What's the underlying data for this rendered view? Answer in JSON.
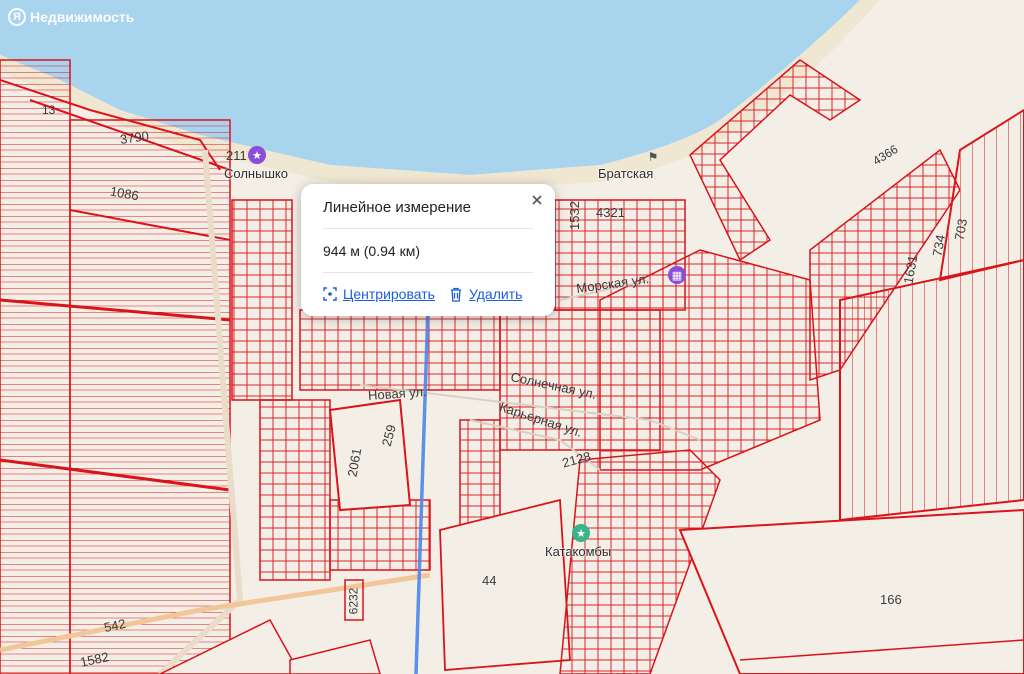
{
  "brand": {
    "name": "Недвижимость",
    "logo_letter": "Я"
  },
  "measure_popup": {
    "title": "Линейное измерение",
    "distance": "944 м (0.94 км)",
    "center_label": "Центрировать",
    "delete_label": "Удалить"
  },
  "streets": {
    "new_street": "Новая ул.",
    "sunny_street": "Солнечная ул.",
    "quarry_street": "Карьерная ул.",
    "sea_street": "Морская ул."
  },
  "pois": {
    "solnyshko": "Солнышко",
    "bratskaya": "Братская",
    "katakomby": "Катакомбы"
  },
  "parcel_numbers": {
    "n13": "13",
    "n3790": "3790",
    "n1086": "1086",
    "n211": "211",
    "n1532": "1532",
    "n4321": "4321",
    "n4366": "4366",
    "n734": "734",
    "n703": "703",
    "n1631": "1631",
    "n2061": "2061",
    "n259": "259",
    "n2128": "2128",
    "n44": "44",
    "n6232": "6232",
    "n542": "542",
    "n1582": "1582",
    "n166": "166"
  },
  "colors": {
    "sea": "#a9d4ee",
    "beach": "#f0e7d2",
    "land": "#f4efe6",
    "parcel_stroke": "#d9141b",
    "measure_line": "#4a86e8",
    "poi_purple": "#8a4fd8",
    "poi_green": "#3bb38a",
    "link": "#1a5fd9"
  }
}
